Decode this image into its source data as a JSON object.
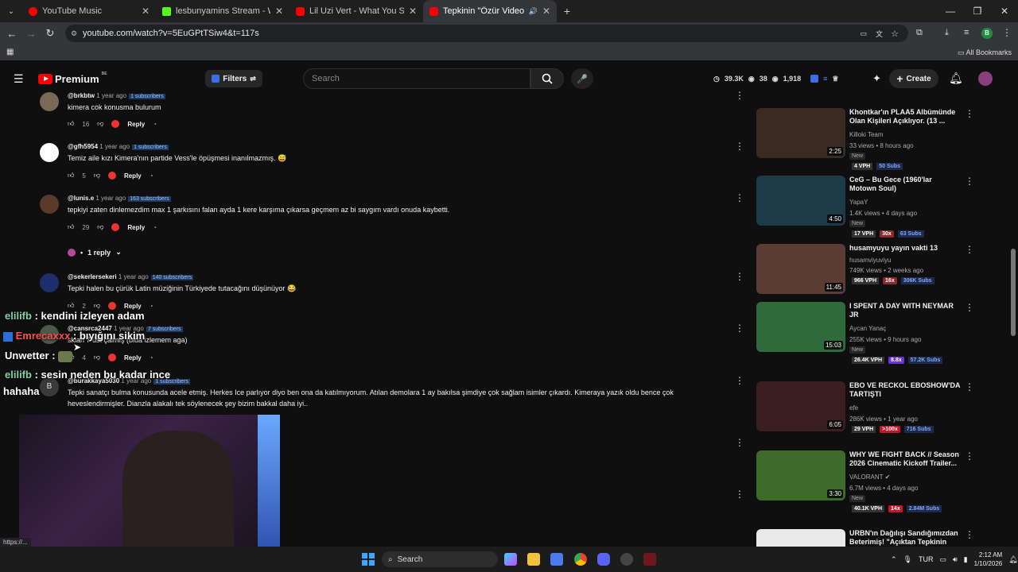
{
  "browser": {
    "tabs": [
      {
        "title": "YouTube Music",
        "color": "#ff0000"
      },
      {
        "title": "lesbunyamins Stream - Watch L",
        "color": "#53fc18"
      },
      {
        "title": "Lil Uzi Vert - What You Saying",
        "color": "#ff0000"
      },
      {
        "title": "Tepkinin \"Özür Videosu\" ve",
        "color": "#ff0000"
      }
    ],
    "url": "youtube.com/watch?v=5EuGPtTSiw4&t=117s",
    "bookmarks_label": "All Bookmarks",
    "profile_initial": "B"
  },
  "youtube": {
    "logo_text": "Premium",
    "logo_region": "BE",
    "filters_label": "Filters",
    "search_placeholder": "Search",
    "stats": [
      "39.3K",
      "38",
      "1,918"
    ],
    "create_label": "Create"
  },
  "comments": [
    {
      "handle": "@brkbtw",
      "time": "1 year ago",
      "subs": "1 subscribers",
      "text": "kimera cok konusma bulurum",
      "likes": "16",
      "reply": "Reply"
    },
    {
      "handle": "@gfh5954",
      "time": "1 year ago",
      "subs": "1 subscribers",
      "text": "Temiz aile kızı Kimera'nın partide Vess'le öpüşmesi inanılmazmış. 😅",
      "likes": "5",
      "reply": "Reply"
    },
    {
      "handle": "@lunis.e",
      "time": "1 year ago",
      "subs": "163 subscribers",
      "text": "tepkiyi zaten dinlemezdim max 1 şarkısını falan ayda 1 kere karşıma çıkarsa geçmem az bi saygım vardı onuda kaybetti.",
      "likes": "29",
      "reply": "Reply",
      "replies_label": "1 reply"
    },
    {
      "handle": "@sekerlersekeri",
      "time": "1 year ago",
      "subs": "140 subscribers",
      "text": "Tepki halen bu çürük Latin müziğinin Türkiyede tutacağını düşünüyor 😂",
      "likes": "2",
      "reply": "Reply"
    },
    {
      "handle": "@cansrca2447",
      "time": "1 year ago",
      "subs": "7 subscribers",
      "text": "skian 7 üst çalmış (bida izlemem aga)",
      "likes": "4",
      "reply": "Reply"
    },
    {
      "handle": "@burakkaya5030",
      "time": "1 year ago",
      "subs": "1 subscribers",
      "avatar_letter": "B",
      "text": "Tepki sanatçı bulma konusunda acele etmiş. Herkes Ice parlıyor diyo ben ona da katılmıyorum. Atılan demolara 1 ay bakılsa şimdiye çok sağlam isimler çıkardı. Kimeraya yazık oldu bence çok",
      "text2": "heveslendirmişler. Dianzla alakalı tek söylenecek şey bizim bakkal daha iyi.."
    }
  ],
  "related": [
    {
      "title": "Khontkar'ın PLAA5 Albümünde Olan Kişileri Açıklıyor. (13 ...",
      "channel": "Killoki Team",
      "meta": "33 views • 8 hours ago",
      "new": "New",
      "duration": "2:25",
      "vph": "4 VPH",
      "mult": "",
      "subs": "50 Subs",
      "thumb": "#3a2a22"
    },
    {
      "title": "CeG – Bu Gece (1960'lar Motown Soul)",
      "channel": "YapaY",
      "meta": "1.4K views • 4 days ago",
      "new": "New",
      "duration": "4:50",
      "vph": "17 VPH",
      "mult": "30x",
      "subs": "63 Subs",
      "thumb": "#1d3b47"
    },
    {
      "title": "husamyuyu yayın vakti 13",
      "channel": "husamviyuviyu",
      "meta": "749K views • 2 weeks ago",
      "new": "",
      "duration": "11:45",
      "vph": "966 VPH",
      "mult": "16x",
      "subs": "306K Subs",
      "thumb": "#5a3c33"
    },
    {
      "title": "I SPENT A DAY WITH NEYMAR JR",
      "channel": "Aycan Yanaç",
      "meta": "255K views • 9 hours ago",
      "new": "New",
      "duration": "15:03",
      "vph": "26.4K VPH",
      "mult": "8.8x",
      "subs": "57.2K Subs",
      "thumb": "#2f6b3a"
    },
    {
      "title": "EBO VE RECKOL EBOSHOW'DA TARTIŞTI",
      "channel": "efe",
      "meta": "286K views • 1 year ago",
      "new": "",
      "duration": "6:05",
      "vph": "29 VPH",
      "mult": ">100x",
      "subs": "716 Subs",
      "thumb": "#3b1e22"
    },
    {
      "title": "WHY WE FIGHT BACK // Season 2026 Cinematic Kickoff Trailer...",
      "channel": "VALORANT",
      "meta": "6.7M views • 4 days ago",
      "new": "New",
      "duration": "3:30",
      "vph": "40.1K VPH",
      "mult": "14x",
      "subs": "2.84M Subs",
      "thumb": "#3d6b2a"
    },
    {
      "title": "URBN'ın Dağılışı Sandığımızdan Beterimiş! \"Açıktan Tepkinin",
      "channel": "",
      "meta": "",
      "new": "",
      "duration": "",
      "vph": "",
      "mult": "",
      "subs": "",
      "thumb": "#e9e9e9"
    }
  ],
  "stream_chat": [
    {
      "user": "elilifb",
      "msg": ": kendini izleyen adam",
      "color": "#7fd1a8"
    },
    {
      "user": "Emrecaxxx",
      "msg": ": bıyığını sikim",
      "color": "#ff4d4d"
    },
    {
      "user": "Unwetter",
      "msg": ":",
      "color": "#ffffff"
    },
    {
      "user": "elilifb",
      "msg": ": sesin neden bu kadar ince",
      "color": "#7fd1a8"
    },
    {
      "user": "",
      "msg": "hahaha",
      "color": "#ffffff"
    }
  ],
  "taskbar": {
    "search": "Search",
    "lang": "TUR",
    "time": "2:12 AM",
    "date": "1/10/2026",
    "status_url": "https://..."
  }
}
